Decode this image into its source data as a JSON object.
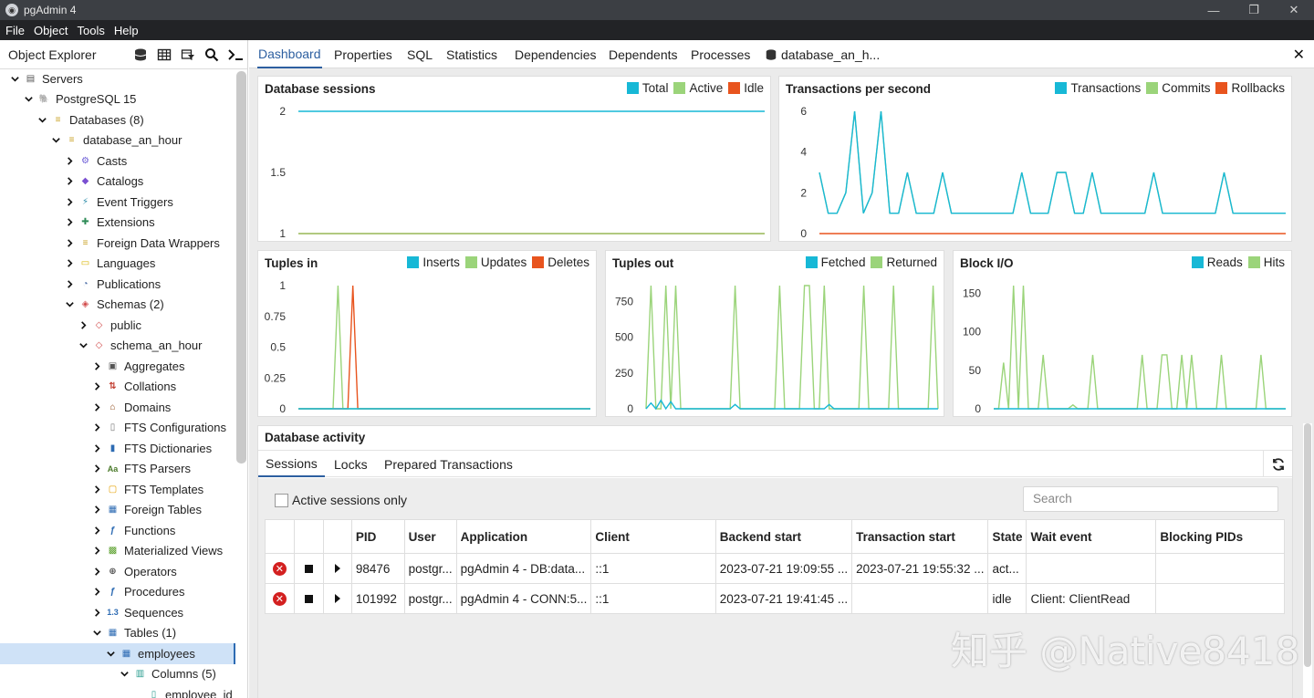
{
  "window": {
    "title": "pgAdmin 4",
    "minimize_glyph": "—",
    "maximize_glyph": "❐",
    "close_glyph": "✕"
  },
  "menu": [
    "File",
    "Object",
    "Tools",
    "Help"
  ],
  "object_explorer": {
    "title": "Object Explorer",
    "tools": [
      "database-icon",
      "grid-icon",
      "filter-icon",
      "search-icon",
      "terminal-icon"
    ],
    "tree": [
      {
        "label": "Servers",
        "depth": 0,
        "expanded": true,
        "icon": "servers-icon"
      },
      {
        "label": "PostgreSQL 15",
        "depth": 1,
        "expanded": true,
        "icon": "postgres-icon"
      },
      {
        "label": "Databases (8)",
        "depth": 2,
        "expanded": true,
        "icon": "databases-icon"
      },
      {
        "label": "database_an_hour",
        "depth": 3,
        "expanded": true,
        "icon": "database-icon"
      },
      {
        "label": "Casts",
        "depth": 4,
        "expanded": false,
        "icon": "casts-icon"
      },
      {
        "label": "Catalogs",
        "depth": 4,
        "expanded": false,
        "icon": "catalogs-icon"
      },
      {
        "label": "Event Triggers",
        "depth": 4,
        "expanded": false,
        "icon": "event-triggers-icon"
      },
      {
        "label": "Extensions",
        "depth": 4,
        "expanded": false,
        "icon": "extensions-icon"
      },
      {
        "label": "Foreign Data Wrappers",
        "depth": 4,
        "expanded": false,
        "icon": "fdw-icon"
      },
      {
        "label": "Languages",
        "depth": 4,
        "expanded": false,
        "icon": "languages-icon"
      },
      {
        "label": "Publications",
        "depth": 4,
        "expanded": false,
        "icon": "publications-icon"
      },
      {
        "label": "Schemas (2)",
        "depth": 4,
        "expanded": true,
        "icon": "schemas-icon"
      },
      {
        "label": "public",
        "depth": 5,
        "expanded": false,
        "icon": "schema-icon"
      },
      {
        "label": "schema_an_hour",
        "depth": 5,
        "expanded": true,
        "icon": "schema-icon"
      },
      {
        "label": "Aggregates",
        "depth": 6,
        "expanded": false,
        "icon": "aggregates-icon"
      },
      {
        "label": "Collations",
        "depth": 6,
        "expanded": false,
        "icon": "collations-icon"
      },
      {
        "label": "Domains",
        "depth": 6,
        "expanded": false,
        "icon": "domains-icon"
      },
      {
        "label": "FTS Configurations",
        "depth": 6,
        "expanded": false,
        "icon": "fts-configurations-icon"
      },
      {
        "label": "FTS Dictionaries",
        "depth": 6,
        "expanded": false,
        "icon": "fts-dictionaries-icon"
      },
      {
        "label": "FTS Parsers",
        "depth": 6,
        "expanded": false,
        "icon": "fts-parsers-icon"
      },
      {
        "label": "FTS Templates",
        "depth": 6,
        "expanded": false,
        "icon": "fts-templates-icon"
      },
      {
        "label": "Foreign Tables",
        "depth": 6,
        "expanded": false,
        "icon": "foreign-tables-icon"
      },
      {
        "label": "Functions",
        "depth": 6,
        "expanded": false,
        "icon": "functions-icon"
      },
      {
        "label": "Materialized Views",
        "depth": 6,
        "expanded": false,
        "icon": "materialized-views-icon"
      },
      {
        "label": "Operators",
        "depth": 6,
        "expanded": false,
        "icon": "operators-icon"
      },
      {
        "label": "Procedures",
        "depth": 6,
        "expanded": false,
        "icon": "procedures-icon"
      },
      {
        "label": "Sequences",
        "depth": 6,
        "expanded": false,
        "icon": "sequences-icon"
      },
      {
        "label": "Tables (1)",
        "depth": 6,
        "expanded": true,
        "icon": "tables-icon"
      },
      {
        "label": "employees",
        "depth": 7,
        "expanded": true,
        "icon": "table-icon",
        "selected": true
      },
      {
        "label": "Columns (5)",
        "depth": 8,
        "expanded": true,
        "icon": "columns-icon"
      },
      {
        "label": "employee_id",
        "depth": 9,
        "leaf": true,
        "icon": "column-icon"
      }
    ]
  },
  "tabs": [
    "Dashboard",
    "Properties",
    "SQL",
    "Statistics",
    "Dependencies",
    "Dependents",
    "Processes",
    "database_an_h..."
  ],
  "active_tab": "Dashboard",
  "colors": {
    "blue": "#17b8d6",
    "green": "#9bd47a",
    "red": "#e8541e",
    "accent": "#2d5fa0"
  },
  "chart_data": [
    {
      "id": "database-sessions",
      "type": "line",
      "title": "Database sessions",
      "legend": [
        "Total",
        "Active",
        "Idle"
      ],
      "yticks": [
        "2",
        "1.5",
        "1"
      ],
      "ylim": [
        1,
        2
      ],
      "series": [
        {
          "name": "Total",
          "color": "#17b8d6",
          "values": [
            2,
            2,
            2,
            2,
            2,
            2,
            2,
            2,
            2,
            2
          ]
        },
        {
          "name": "Active",
          "color": "#9bd47a",
          "values": [
            1,
            1,
            1,
            1,
            1,
            1,
            1,
            1,
            1,
            1
          ]
        },
        {
          "name": "Idle",
          "color": "#e8541e",
          "values": [
            1,
            1,
            1,
            1,
            1,
            1,
            1,
            1,
            1,
            1
          ]
        }
      ]
    },
    {
      "id": "transactions-per-second",
      "type": "line",
      "title": "Transactions per second",
      "legend": [
        "Transactions",
        "Commits",
        "Rollbacks"
      ],
      "yticks": [
        "6",
        "4",
        "2",
        "0"
      ],
      "ylim": [
        0,
        6
      ],
      "series": [
        {
          "name": "Transactions",
          "color": "#17b8d6",
          "values": [
            3,
            1,
            1,
            2,
            6,
            1,
            2,
            6,
            1,
            1,
            3,
            1,
            1,
            1,
            3,
            1,
            1,
            1,
            1,
            1,
            1,
            1,
            1,
            3,
            1,
            1,
            1,
            3,
            3,
            1,
            1,
            3,
            1,
            1,
            1,
            1,
            1,
            1,
            3,
            1,
            1,
            1,
            1,
            1,
            1,
            1,
            3,
            1,
            1,
            1,
            1,
            1,
            1,
            1
          ]
        },
        {
          "name": "Commits",
          "color": "#9bd47a",
          "values": [
            3,
            1,
            1,
            2,
            6,
            1,
            2,
            6,
            1,
            1,
            3,
            1,
            1,
            1,
            3,
            1,
            1,
            1,
            1,
            1,
            1,
            1,
            1,
            3,
            1,
            1,
            1,
            3,
            3,
            1,
            1,
            3,
            1,
            1,
            1,
            1,
            1,
            1,
            3,
            1,
            1,
            1,
            1,
            1,
            1,
            1,
            3,
            1,
            1,
            1,
            1,
            1,
            1,
            1
          ]
        },
        {
          "name": "Rollbacks",
          "color": "#e8541e",
          "values": [
            0,
            0,
            0,
            0,
            0,
            0,
            0,
            0,
            0,
            0,
            0,
            0,
            0,
            0,
            0,
            0,
            0,
            0,
            0,
            0,
            0,
            0,
            0,
            0,
            0,
            0,
            0,
            0,
            0,
            0,
            0,
            0,
            0,
            0,
            0,
            0,
            0,
            0,
            0,
            0,
            0,
            0,
            0,
            0,
            0,
            0,
            0,
            0,
            0,
            0,
            0,
            0,
            0,
            0
          ]
        }
      ]
    },
    {
      "id": "tuples-in",
      "type": "line",
      "title": "Tuples in",
      "legend": [
        "Inserts",
        "Updates",
        "Deletes"
      ],
      "yticks": [
        "1",
        "0.75",
        "0.5",
        "0.25",
        "0"
      ],
      "ylim": [
        0,
        1
      ],
      "series": [
        {
          "name": "Inserts",
          "color": "#17b8d6",
          "values": [
            0,
            0,
            0,
            0,
            0,
            0,
            0,
            0,
            0,
            0,
            0,
            0,
            0,
            0,
            0,
            0,
            0,
            0,
            0,
            0,
            0,
            0,
            0,
            0,
            0,
            0,
            0,
            0,
            0,
            0,
            0,
            0,
            0,
            0,
            0,
            0,
            0,
            0,
            0,
            0,
            0,
            0,
            0,
            0,
            0,
            0,
            0,
            0,
            0,
            0,
            0,
            0,
            0,
            0,
            0,
            0,
            0,
            0,
            0,
            0
          ]
        },
        {
          "name": "Updates",
          "color": "#9bd47a",
          "values": [
            0,
            0,
            0,
            0,
            0,
            0,
            0,
            0,
            1,
            0,
            0,
            0,
            0,
            0,
            0,
            0,
            0,
            0,
            0,
            0,
            0,
            0,
            0,
            0,
            0,
            0,
            0,
            0,
            0,
            0,
            0,
            0,
            0,
            0,
            0,
            0,
            0,
            0,
            0,
            0,
            0,
            0,
            0,
            0,
            0,
            0,
            0,
            0,
            0,
            0,
            0,
            0,
            0,
            0,
            0,
            0,
            0,
            0,
            0,
            0
          ]
        },
        {
          "name": "Deletes",
          "color": "#e8541e",
          "values": [
            0,
            0,
            0,
            0,
            0,
            0,
            0,
            0,
            0,
            0,
            0,
            1,
            0,
            0,
            0,
            0,
            0,
            0,
            0,
            0,
            0,
            0,
            0,
            0,
            0,
            0,
            0,
            0,
            0,
            0,
            0,
            0,
            0,
            0,
            0,
            0,
            0,
            0,
            0,
            0,
            0,
            0,
            0,
            0,
            0,
            0,
            0,
            0,
            0,
            0,
            0,
            0,
            0,
            0,
            0,
            0,
            0,
            0,
            0,
            0
          ]
        }
      ]
    },
    {
      "id": "tuples-out",
      "type": "line",
      "title": "Tuples out",
      "legend": [
        "Fetched",
        "Returned"
      ],
      "yticks": [
        "750",
        "500",
        "250",
        "0"
      ],
      "ylim": [
        0,
        860
      ],
      "series": [
        {
          "name": "Fetched",
          "color": "#17b8d6",
          "values": [
            0,
            40,
            0,
            60,
            0,
            50,
            0,
            0,
            0,
            0,
            0,
            0,
            0,
            0,
            0,
            0,
            0,
            0,
            30,
            0,
            0,
            0,
            0,
            0,
            0,
            0,
            0,
            0,
            0,
            0,
            0,
            0,
            0,
            0,
            0,
            0,
            0,
            30,
            0,
            0,
            0,
            0,
            0,
            0,
            0,
            0,
            0,
            0,
            0,
            0,
            0,
            0,
            0,
            0,
            0,
            0,
            0,
            0,
            0,
            0
          ]
        },
        {
          "name": "Returned",
          "color": "#9bd47a",
          "values": [
            0,
            860,
            0,
            0,
            860,
            0,
            860,
            0,
            0,
            0,
            0,
            0,
            0,
            0,
            0,
            0,
            0,
            0,
            860,
            0,
            0,
            0,
            0,
            0,
            0,
            0,
            0,
            860,
            0,
            0,
            0,
            0,
            860,
            860,
            0,
            0,
            860,
            0,
            0,
            0,
            0,
            0,
            0,
            0,
            860,
            0,
            0,
            0,
            0,
            0,
            860,
            0,
            0,
            0,
            0,
            0,
            0,
            0,
            860,
            0
          ]
        }
      ]
    },
    {
      "id": "block-io",
      "type": "line",
      "title": "Block I/O",
      "legend": [
        "Reads",
        "Hits"
      ],
      "yticks": [
        "150",
        "100",
        "50",
        "0"
      ],
      "ylim": [
        0,
        160
      ],
      "series": [
        {
          "name": "Reads",
          "color": "#17b8d6",
          "values": [
            0,
            0,
            0,
            0,
            0,
            0,
            0,
            0,
            0,
            0,
            0,
            0,
            0,
            0,
            0,
            0,
            0,
            0,
            0,
            0,
            0,
            0,
            0,
            0,
            0,
            0,
            0,
            0,
            0,
            0,
            0,
            0,
            0,
            0,
            0,
            0,
            0,
            0,
            0,
            0,
            0,
            0,
            0,
            0,
            0,
            0,
            0,
            0,
            0,
            0,
            0,
            0,
            0,
            0,
            0,
            0,
            0,
            0,
            0,
            0
          ]
        },
        {
          "name": "Hits",
          "color": "#9bd47a",
          "values": [
            0,
            0,
            60,
            0,
            160,
            0,
            160,
            0,
            0,
            0,
            70,
            0,
            0,
            0,
            0,
            0,
            5,
            0,
            0,
            0,
            70,
            0,
            0,
            0,
            0,
            0,
            0,
            0,
            0,
            0,
            70,
            0,
            0,
            0,
            70,
            70,
            0,
            0,
            70,
            0,
            70,
            0,
            0,
            0,
            0,
            0,
            70,
            0,
            0,
            0,
            0,
            0,
            0,
            0,
            70,
            0,
            0,
            0,
            0,
            0
          ]
        }
      ]
    }
  ],
  "activity": {
    "title": "Database activity",
    "subtabs": [
      "Sessions",
      "Locks",
      "Prepared Transactions"
    ],
    "active_only_label": "Active sessions only",
    "search_placeholder": "Search",
    "columns": [
      "",
      "",
      "",
      "PID",
      "User",
      "Application",
      "Client",
      "Backend start",
      "Transaction start",
      "State",
      "Wait event",
      "Blocking PIDs"
    ],
    "rows": [
      {
        "pid": "98476",
        "user": "postgr...",
        "application": "pgAdmin 4 - DB:data...",
        "client": "::1",
        "backend_start": "2023-07-21 19:09:55 ...",
        "transaction_start": "2023-07-21 19:55:32 ...",
        "state": "act...",
        "wait_event": "",
        "blocking_pids": ""
      },
      {
        "pid": "101992",
        "user": "postgr...",
        "application": "pgAdmin 4 - CONN:5...",
        "client": "::1",
        "backend_start": "2023-07-21 19:41:45 ...",
        "transaction_start": "",
        "state": "idle",
        "wait_event": "Client: ClientRead",
        "blocking_pids": ""
      }
    ]
  },
  "watermark": "知乎 @Native8418"
}
